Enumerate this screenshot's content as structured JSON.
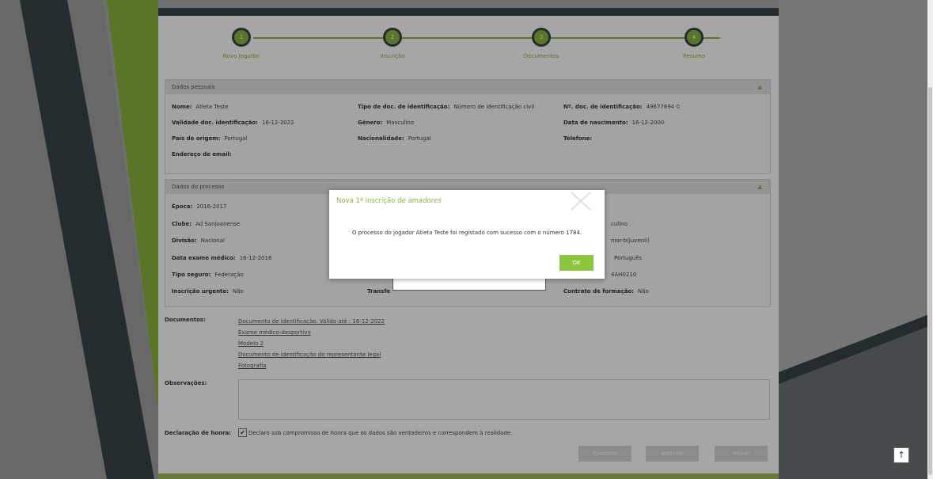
{
  "steps": [
    {
      "num": "1",
      "label": "Novo Jogador"
    },
    {
      "num": "2",
      "label": "Inscrição"
    },
    {
      "num": "3",
      "label": "Documentos"
    },
    {
      "num": "4",
      "label": "Resumo"
    }
  ],
  "personal": {
    "title": "Dados pessoais",
    "fields": {
      "nome": {
        "label": "Nome:",
        "value": "Atleta Teste"
      },
      "tipo_doc": {
        "label": "Tipo de doc. de identificação:",
        "value": "Número de identificação civil"
      },
      "num_doc": {
        "label": "Nº. doc. de identificação:",
        "value": "49677694 0"
      },
      "validade": {
        "label": "Validade doc. identificação:",
        "value": "16-12-2022"
      },
      "genero": {
        "label": "Género:",
        "value": "Masculino"
      },
      "nascimento": {
        "label": "Data de nascimento:",
        "value": "16-12-2000"
      },
      "pais": {
        "label": "País de origem:",
        "value": "Portugal"
      },
      "nacionalidade": {
        "label": "Nacionalidade:",
        "value": "Portugal"
      },
      "telefone": {
        "label": "Telefone:",
        "value": ""
      },
      "email": {
        "label": "Endereço de email:",
        "value": ""
      }
    }
  },
  "process": {
    "title": "Dados do processo",
    "fields": {
      "epoca": {
        "label": "Época:",
        "value": "2016-2017"
      },
      "clube": {
        "label": "Clube:",
        "value": "Ad Sanjoanense"
      },
      "divisao": {
        "label": "Divisão:",
        "value": "Nacional"
      },
      "exame": {
        "label": "Data exame médico:",
        "value": "16-12-2016"
      },
      "seguro": {
        "label": "Tipo seguro:",
        "value": "Federação"
      },
      "urgente": {
        "label": "Inscrição urgente:",
        "value": "Não"
      },
      "transf": {
        "label": "Transfe",
        "value": ""
      },
      "partial_genero": {
        "label": "",
        "value": "culino"
      },
      "partial_escalao": {
        "label": "",
        "value": "nior-b(juvenil)"
      },
      "partial_idioma": {
        "label": "",
        "value": "Português"
      },
      "partial_code": {
        "label": "",
        "value": "4AH0210"
      },
      "contrato": {
        "label": "Contrato de formação:",
        "value": "Não"
      }
    }
  },
  "documents": {
    "label": "Documentos:",
    "links": [
      "Documento de identificação. Válido até : 16-12-2022",
      "Exame médico-desportivo",
      "Modelo 2",
      "Documento de identificação do representante legal",
      "Fotografia"
    ]
  },
  "observacoes": {
    "label": "Observações:",
    "value": ""
  },
  "declaracao": {
    "label": "Declaração de honra:",
    "text": "Declaro sob compromisso de honra que os dados são verdadeiros e correspondem à realidade.",
    "checked": true
  },
  "buttons": {
    "cancel": "Cancelar",
    "previous": "Anterior",
    "submit": "Inserir"
  },
  "dialog": {
    "title": "Nova 1ª inscrição de amadores",
    "message": "O processo do jogador Atleta Teste foi registado com sucesso com o número 1784.",
    "ok": "OK"
  },
  "scroll_top_glyph": "↑",
  "colors": {
    "accent": "#8bb43d",
    "dark": "#3a4449",
    "ok_button": "#8bc63e"
  },
  "icons": {
    "close": "close-icon",
    "collapse": "chevron-up-icon",
    "scroll_top": "arrow-up-icon"
  }
}
